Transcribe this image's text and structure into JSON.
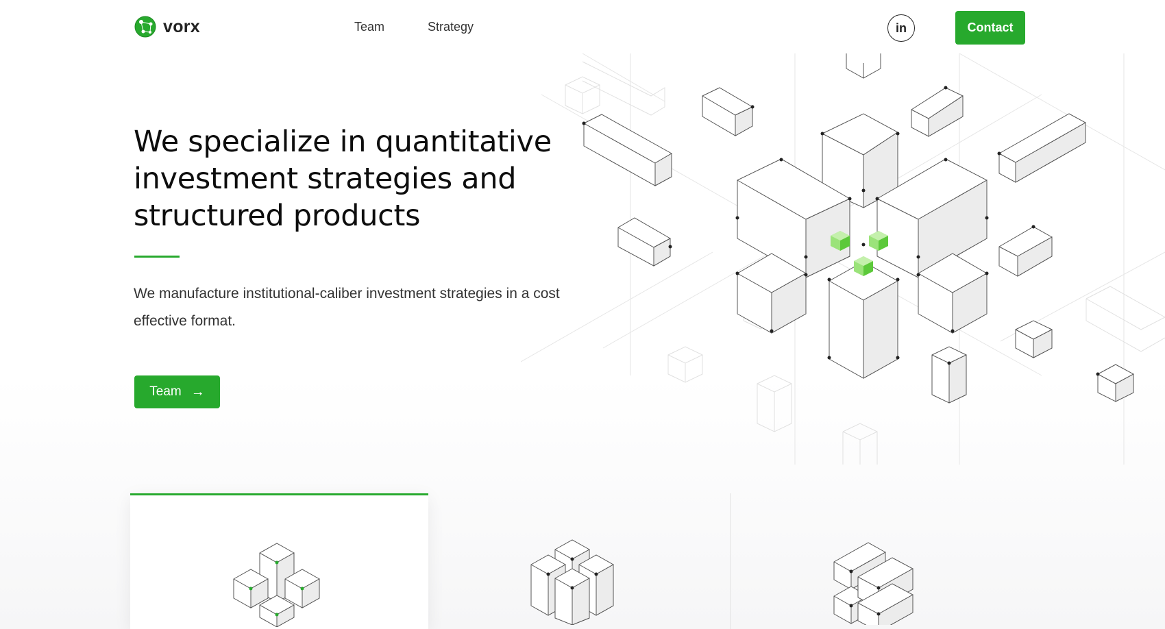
{
  "header": {
    "logo_text": "vorx",
    "nav": [
      {
        "label": "Team"
      },
      {
        "label": "Strategy"
      }
    ],
    "social": {
      "label": "in",
      "icon": "linkedin-icon"
    },
    "contact_label": "Contact"
  },
  "hero": {
    "title": "We specialize in quantitative investment strategies and structured products",
    "description": "We manufacture institutional-caliber investment strategies in a cost effective format.",
    "cta_label": "Team",
    "cta_icon": "arrow-right-icon"
  },
  "cards": [
    {
      "icon": "cube-cluster-icon",
      "active": true
    },
    {
      "icon": "cube-blocks-icon",
      "active": false
    },
    {
      "icon": "cube-stack-icon",
      "active": false
    }
  ],
  "colors": {
    "accent": "#27a92d",
    "text": "#0d0d0d",
    "body_text": "#333333",
    "highlight_cube": "#7ed957"
  }
}
